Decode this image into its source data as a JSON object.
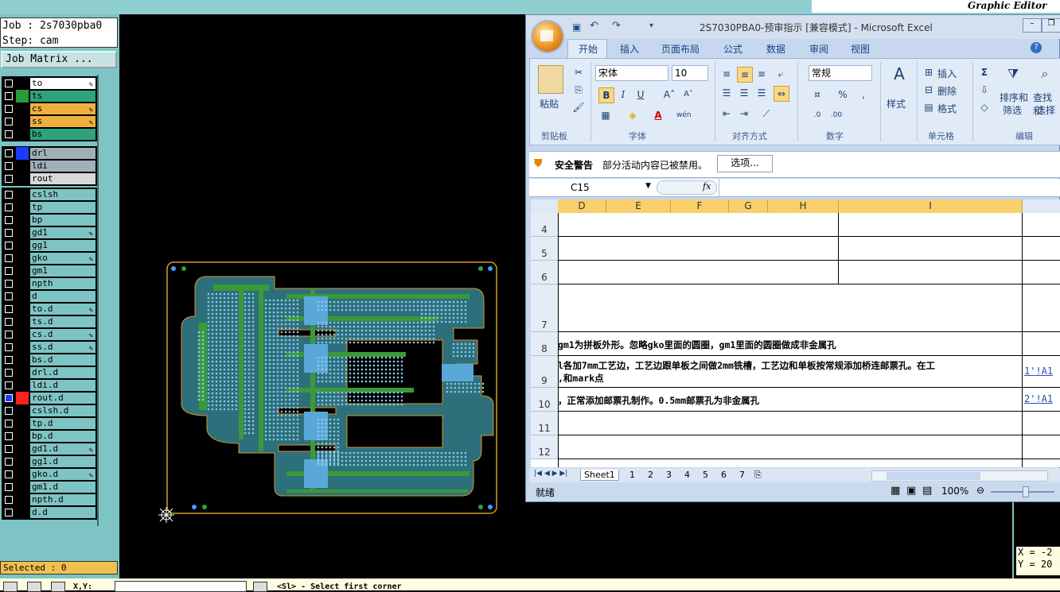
{
  "genesis": {
    "title": "Graphic Editor",
    "job": "Job : 2s7030pba0",
    "step": "Step: cam",
    "matrix_button": "Job Matrix ...",
    "selected": "Selected : 0",
    "coords": {
      "x": "X = -2",
      "y": "Y = 20"
    },
    "prompt": "<Sl> - Select first corner",
    "coord_label": "X,Y:",
    "layers": [
      {
        "name": "to",
        "color": "#ffffff",
        "swatch": "#000000",
        "pen": true
      },
      {
        "name": "ts",
        "color": "#2ea37a",
        "swatch": "#2a9a3a",
        "pen": false
      },
      {
        "name": "cs",
        "color": "#f0b040",
        "swatch": "#000000",
        "pen": true
      },
      {
        "name": "ss",
        "color": "#f0b040",
        "swatch": "#000000",
        "pen": true
      },
      {
        "name": "bs",
        "color": "#2ea37a",
        "swatch": "#000000",
        "pen": false
      },
      {
        "name": "drl",
        "color": "#9fb0b8",
        "swatch": "#1a3cff",
        "pen": false
      },
      {
        "name": "ldi",
        "color": "#9fb0b8",
        "swatch": "#000000",
        "pen": false
      },
      {
        "name": "rout",
        "color": "#d8d8d8",
        "swatch": "#000000",
        "pen": false
      },
      {
        "name": "cslsh",
        "color": "#7fc4c4",
        "swatch": "#000000",
        "pen": false
      },
      {
        "name": "tp",
        "color": "#7fc4c4",
        "swatch": "#000000",
        "pen": false
      },
      {
        "name": "bp",
        "color": "#7fc4c4",
        "swatch": "#000000",
        "pen": false
      },
      {
        "name": "gd1",
        "color": "#7fc4c4",
        "swatch": "#000000",
        "pen": true
      },
      {
        "name": "gg1",
        "color": "#7fc4c4",
        "swatch": "#000000",
        "pen": false
      },
      {
        "name": "gko",
        "color": "#7fc4c4",
        "swatch": "#000000",
        "pen": true
      },
      {
        "name": "gm1",
        "color": "#7fc4c4",
        "swatch": "#000000",
        "pen": false
      },
      {
        "name": "npth",
        "color": "#7fc4c4",
        "swatch": "#000000",
        "pen": false
      },
      {
        "name": "d",
        "color": "#7fc4c4",
        "swatch": "#000000",
        "pen": false
      },
      {
        "name": "to.d",
        "color": "#7fc4c4",
        "swatch": "#000000",
        "pen": true
      },
      {
        "name": "ts.d",
        "color": "#7fc4c4",
        "swatch": "#000000",
        "pen": false
      },
      {
        "name": "cs.d",
        "color": "#7fc4c4",
        "swatch": "#000000",
        "pen": true
      },
      {
        "name": "ss.d",
        "color": "#7fc4c4",
        "swatch": "#000000",
        "pen": true
      },
      {
        "name": "bs.d",
        "color": "#7fc4c4",
        "swatch": "#000000",
        "pen": false
      },
      {
        "name": "drl.d",
        "color": "#7fc4c4",
        "swatch": "#000000",
        "pen": false
      },
      {
        "name": "ldi.d",
        "color": "#7fc4c4",
        "swatch": "#000000",
        "pen": false
      },
      {
        "name": "rout.d",
        "color": "#7fc4c4",
        "swatch": "#ff2020",
        "pen": false,
        "active": true
      },
      {
        "name": "cslsh.d",
        "color": "#7fc4c4",
        "swatch": "#000000",
        "pen": false
      },
      {
        "name": "tp.d",
        "color": "#7fc4c4",
        "swatch": "#000000",
        "pen": false
      },
      {
        "name": "bp.d",
        "color": "#7fc4c4",
        "swatch": "#000000",
        "pen": false
      },
      {
        "name": "gd1.d",
        "color": "#7fc4c4",
        "swatch": "#000000",
        "pen": true
      },
      {
        "name": "gg1.d",
        "color": "#7fc4c4",
        "swatch": "#000000",
        "pen": false
      },
      {
        "name": "gko.d",
        "color": "#7fc4c4",
        "swatch": "#000000",
        "pen": true
      },
      {
        "name": "gm1.d",
        "color": "#7fc4c4",
        "swatch": "#000000",
        "pen": false
      },
      {
        "name": "npth.d",
        "color": "#7fc4c4",
        "swatch": "#000000",
        "pen": false
      },
      {
        "name": "d.d",
        "color": "#7fc4c4",
        "swatch": "#000000",
        "pen": false
      }
    ]
  },
  "excel": {
    "title": "2S7030PBA0-预审指示 [兼容模式] - Microsoft Excel",
    "tabs": [
      "开始",
      "插入",
      "页面布局",
      "公式",
      "数据",
      "审阅",
      "视图"
    ],
    "clipboard": {
      "paste": "粘贴",
      "label": "剪贴板"
    },
    "font": {
      "name": "宋体",
      "size": "10",
      "label": "字体"
    },
    "alignment": {
      "label": "对齐方式"
    },
    "number": {
      "format": "常规",
      "label": "数字"
    },
    "styles": {
      "label": "样式"
    },
    "cells": {
      "insert": "插入",
      "delete": "删除",
      "format": "格式",
      "label": "单元格"
    },
    "editing": {
      "sort": "排序和",
      "sort2": "筛选",
      "find": "查找和",
      "find2": "选择",
      "label": "编辑"
    },
    "security": {
      "title": "安全警告",
      "message": "部分活动内容已被禁用。",
      "options": "选项..."
    },
    "namebox": "C15",
    "fx": "fx",
    "columns": [
      "D",
      "E",
      "F",
      "G",
      "H",
      "I"
    ],
    "rows": [
      {
        "num": "4",
        "text": ""
      },
      {
        "num": "5",
        "text": ""
      },
      {
        "num": "6",
        "text": ""
      },
      {
        "num": "7",
        "text": ""
      },
      {
        "num": "8",
        "text": "gm1为拼板外形。忽略gko里面的圆圈，gm1里面的圆圈做成非金属孔"
      },
      {
        "num": "9",
        "text": "l各加7mm工艺边，工艺边跟单板之间做2mm铣槽，工艺边和单板按常规添加桥连邮票孔。在工",
        "text2": ",和mark点",
        "link": "1'!A1"
      },
      {
        "num": "10",
        "text": "，正常添加邮票孔制作。0.5mm邮票孔为非金属孔",
        "link": "2'!A1"
      },
      {
        "num": "11",
        "text": ""
      },
      {
        "num": "12",
        "text": ""
      }
    ],
    "sheet_tabs": [
      "Sheet1",
      "1",
      "2",
      "3",
      "4",
      "5",
      "6",
      "7"
    ],
    "status": "就绪",
    "zoom": "100%"
  }
}
